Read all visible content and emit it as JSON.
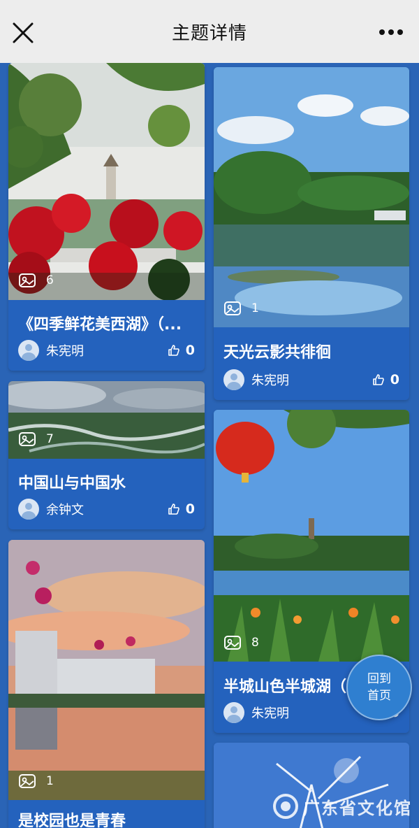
{
  "header": {
    "title": "主题详情"
  },
  "cards": [
    {
      "title": "《四季鲜花美西湖》（...",
      "count": "6",
      "author": "朱宪明",
      "likes": "0"
    },
    {
      "title": "天光云影共徘徊",
      "count": "1",
      "author": "朱宪明",
      "likes": "0"
    },
    {
      "title": "中国山与中国水",
      "count": "7",
      "author": "余钟文",
      "likes": "0"
    },
    {
      "title": "半城山色半城湖（",
      "count": "8",
      "author": "朱宪明",
      "likes": "0"
    },
    {
      "title": "是校园也是青春",
      "count": "1"
    }
  ],
  "fab": {
    "line1": "回到",
    "line2": "首页"
  },
  "watermark": {
    "logo_text": "广东省文化馆"
  },
  "colors": {
    "background": "#2a64b6",
    "card": "#2462bd",
    "topbar": "#ededed"
  },
  "icons": {
    "close": "close-icon",
    "more": "more-icon",
    "gallery": "image-icon",
    "like": "thumbs-up-icon"
  }
}
